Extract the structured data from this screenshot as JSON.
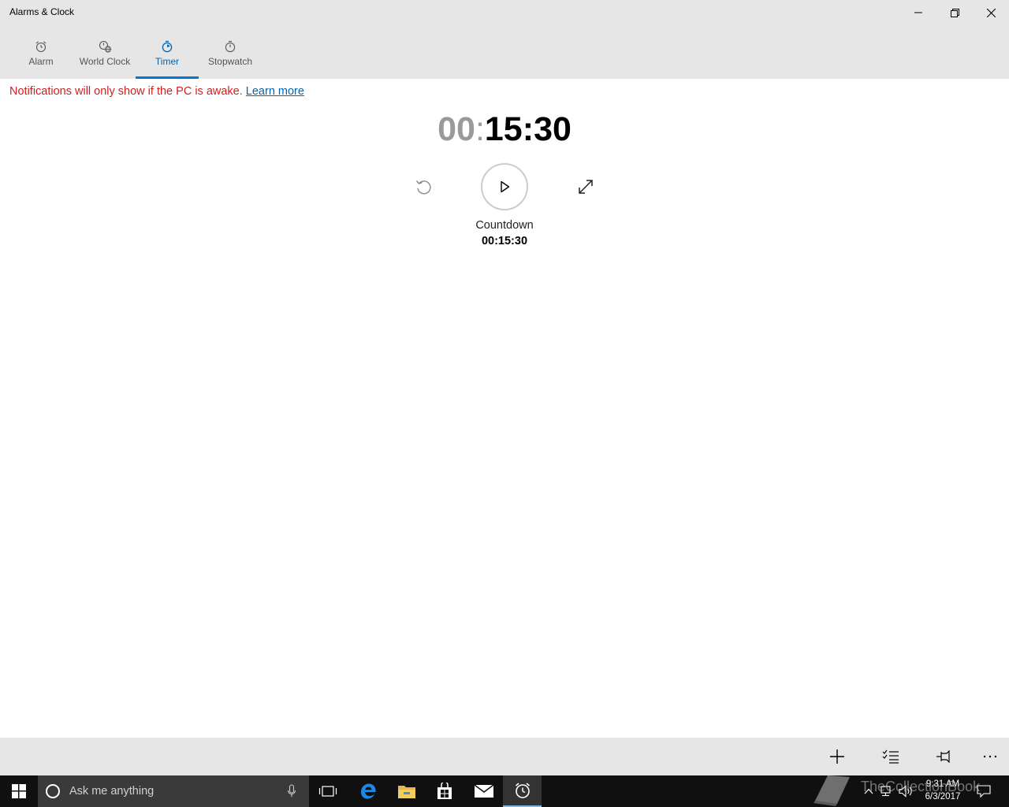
{
  "window": {
    "title": "Alarms & Clock"
  },
  "tabs": [
    {
      "label": "Alarm",
      "icon": "alarm-clock-icon",
      "active": false
    },
    {
      "label": "World Clock",
      "icon": "world-clock-icon",
      "active": false
    },
    {
      "label": "Timer",
      "icon": "timer-icon",
      "active": true
    },
    {
      "label": "Stopwatch",
      "icon": "stopwatch-icon",
      "active": false
    }
  ],
  "notice": {
    "text": "Notifications will only show if the PC is awake.",
    "link": "Learn more"
  },
  "timer": {
    "hours": "00",
    "minutes": "15",
    "seconds": "30",
    "name": "Countdown",
    "value": "00:15:30"
  },
  "commandbar": {
    "icons": [
      "add-icon",
      "select-list-icon",
      "pin-icon",
      "more-icon"
    ]
  },
  "taskbar": {
    "search_placeholder": "Ask me anything",
    "time": "9:31 AM",
    "date": "6/3/2017",
    "watermark": "TheCollectionBook"
  },
  "colors": {
    "accent": "#0078d7",
    "notice": "#d01f1f",
    "link": "#0063b1",
    "chrome": "#e6e6e6",
    "taskbar": "#101010"
  }
}
